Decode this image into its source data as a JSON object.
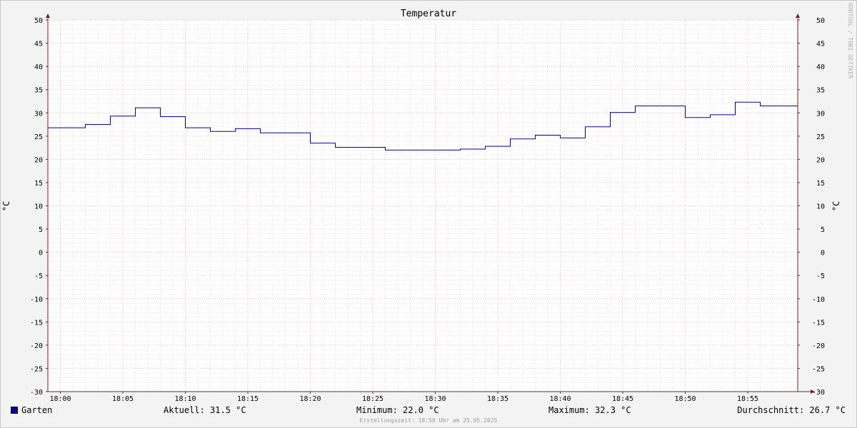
{
  "chart_data": {
    "type": "line",
    "title": "Temperatur",
    "ylabel": "°C",
    "ylabel_right": "°C",
    "ylim": [
      -30,
      50
    ],
    "yticks": [
      50,
      45,
      40,
      35,
      30,
      25,
      20,
      15,
      10,
      5,
      0,
      -5,
      -10,
      -15,
      -20,
      -25,
      -30
    ],
    "xticks": [
      "18:00",
      "18:05",
      "18:10",
      "18:15",
      "18:20",
      "18:25",
      "18:30",
      "18:35",
      "18:40",
      "18:45",
      "18:50",
      "18:55"
    ],
    "xlim_minutes_after_1800": [
      -1,
      59
    ],
    "grid": true,
    "legend_placement": "bottom-left",
    "series": [
      {
        "name": "Garten",
        "color": "#0000a0",
        "style": "step",
        "x": [
          -1,
          2,
          4,
          6,
          8,
          10,
          12,
          14,
          16,
          18,
          20,
          22,
          24,
          26,
          28,
          30,
          32,
          34,
          36,
          38,
          40,
          42,
          44,
          46,
          48,
          50,
          52,
          54,
          56,
          59
        ],
        "values": [
          26.8,
          27.5,
          29.3,
          31.1,
          29.2,
          26.8,
          26.0,
          26.6,
          25.7,
          25.7,
          23.5,
          22.6,
          22.6,
          22.0,
          22.0,
          22.0,
          22.2,
          22.8,
          24.4,
          25.2,
          24.6,
          27.0,
          30.1,
          31.5,
          31.5,
          29.0,
          29.6,
          32.3,
          31.5,
          31.5
        ]
      }
    ]
  },
  "legend": {
    "series_name": "Garten",
    "current": "Aktuell: 31.5 °C",
    "minimum": "Minimum: 22.0 °C",
    "maximum": "Maximum: 32.3 °C",
    "average": "Durchschnitt: 26.7 °C"
  },
  "footer": "Erstellungszeit: 18:58 Uhr am 25.05.2025",
  "watermark": "RRDTOOL / TOBI OETIKER",
  "colors": {
    "series": "#0000a0",
    "major_grid": "#e8a0a0",
    "minor_grid": "#d0d0d0",
    "axis": "#7a2020",
    "plot_background": "#ffffff"
  }
}
